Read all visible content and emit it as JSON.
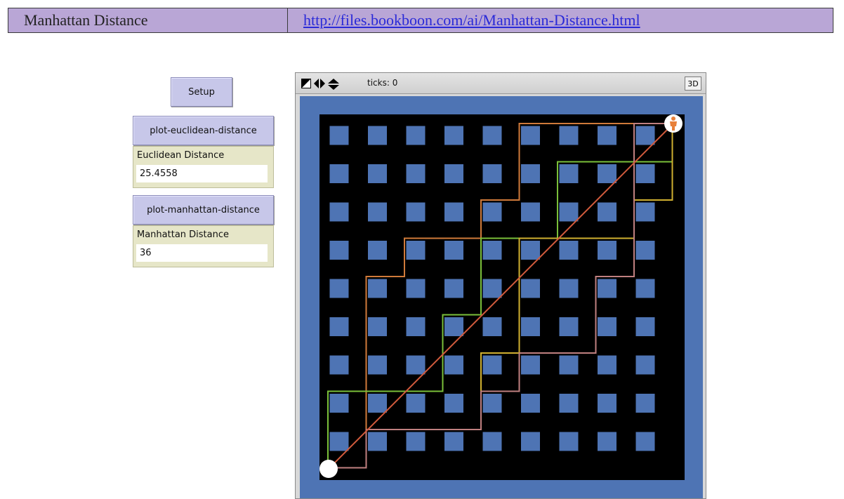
{
  "header": {
    "title": "Manhattan Distance",
    "link": "http://files.bookboon.com/ai/Manhattan-Distance.html"
  },
  "buttons": {
    "setup": "Setup",
    "plot_euclidean": "plot-euclidean-distance",
    "plot_manhattan": "plot-manhattan-distance"
  },
  "monitors": {
    "euclidean": {
      "label": "Euclidean Distance",
      "value": "25.4558"
    },
    "manhattan": {
      "label": "Manhattan Distance",
      "value": "36"
    }
  },
  "view": {
    "ticks_label": "ticks: 0",
    "three_d_label": "3D"
  },
  "world": {
    "colors": {
      "background": "#000000",
      "patch_border": "#4e74b4",
      "block": "#4e74b4",
      "euclid_line": "#d05a3c",
      "start_node": "#ffffff",
      "goal_turtle": "#e8803a"
    },
    "start_grid": [
      0,
      9
    ],
    "goal_grid": [
      9,
      0
    ],
    "paths": [
      {
        "color": "#d07a3a",
        "points": [
          [
            0,
            9
          ],
          [
            1,
            9
          ],
          [
            1,
            4
          ],
          [
            2,
            4
          ],
          [
            2,
            3
          ],
          [
            4,
            3
          ],
          [
            4,
            2
          ],
          [
            5,
            2
          ],
          [
            5,
            0
          ],
          [
            9,
            0
          ]
        ]
      },
      {
        "color": "#7abf3a",
        "points": [
          [
            0,
            9
          ],
          [
            0,
            7
          ],
          [
            3,
            7
          ],
          [
            3,
            5
          ],
          [
            4,
            5
          ],
          [
            4,
            3
          ],
          [
            6,
            3
          ],
          [
            6,
            1
          ],
          [
            9,
            1
          ],
          [
            9,
            0
          ]
        ]
      },
      {
        "color": "#d0b030",
        "points": [
          [
            0,
            9
          ],
          [
            1,
            9
          ],
          [
            1,
            8
          ],
          [
            4,
            8
          ],
          [
            4,
            6
          ],
          [
            5,
            6
          ],
          [
            5,
            4
          ],
          [
            5,
            3
          ],
          [
            8,
            3
          ],
          [
            8,
            2
          ],
          [
            9,
            2
          ],
          [
            9,
            0
          ]
        ]
      },
      {
        "color": "#c08080",
        "points": [
          [
            0,
            9
          ],
          [
            1,
            9
          ],
          [
            1,
            8
          ],
          [
            4,
            8
          ],
          [
            4,
            7
          ],
          [
            5,
            7
          ],
          [
            5,
            6
          ],
          [
            7,
            6
          ],
          [
            7,
            4
          ],
          [
            8,
            4
          ],
          [
            8,
            0
          ],
          [
            9,
            0
          ]
        ]
      }
    ]
  }
}
